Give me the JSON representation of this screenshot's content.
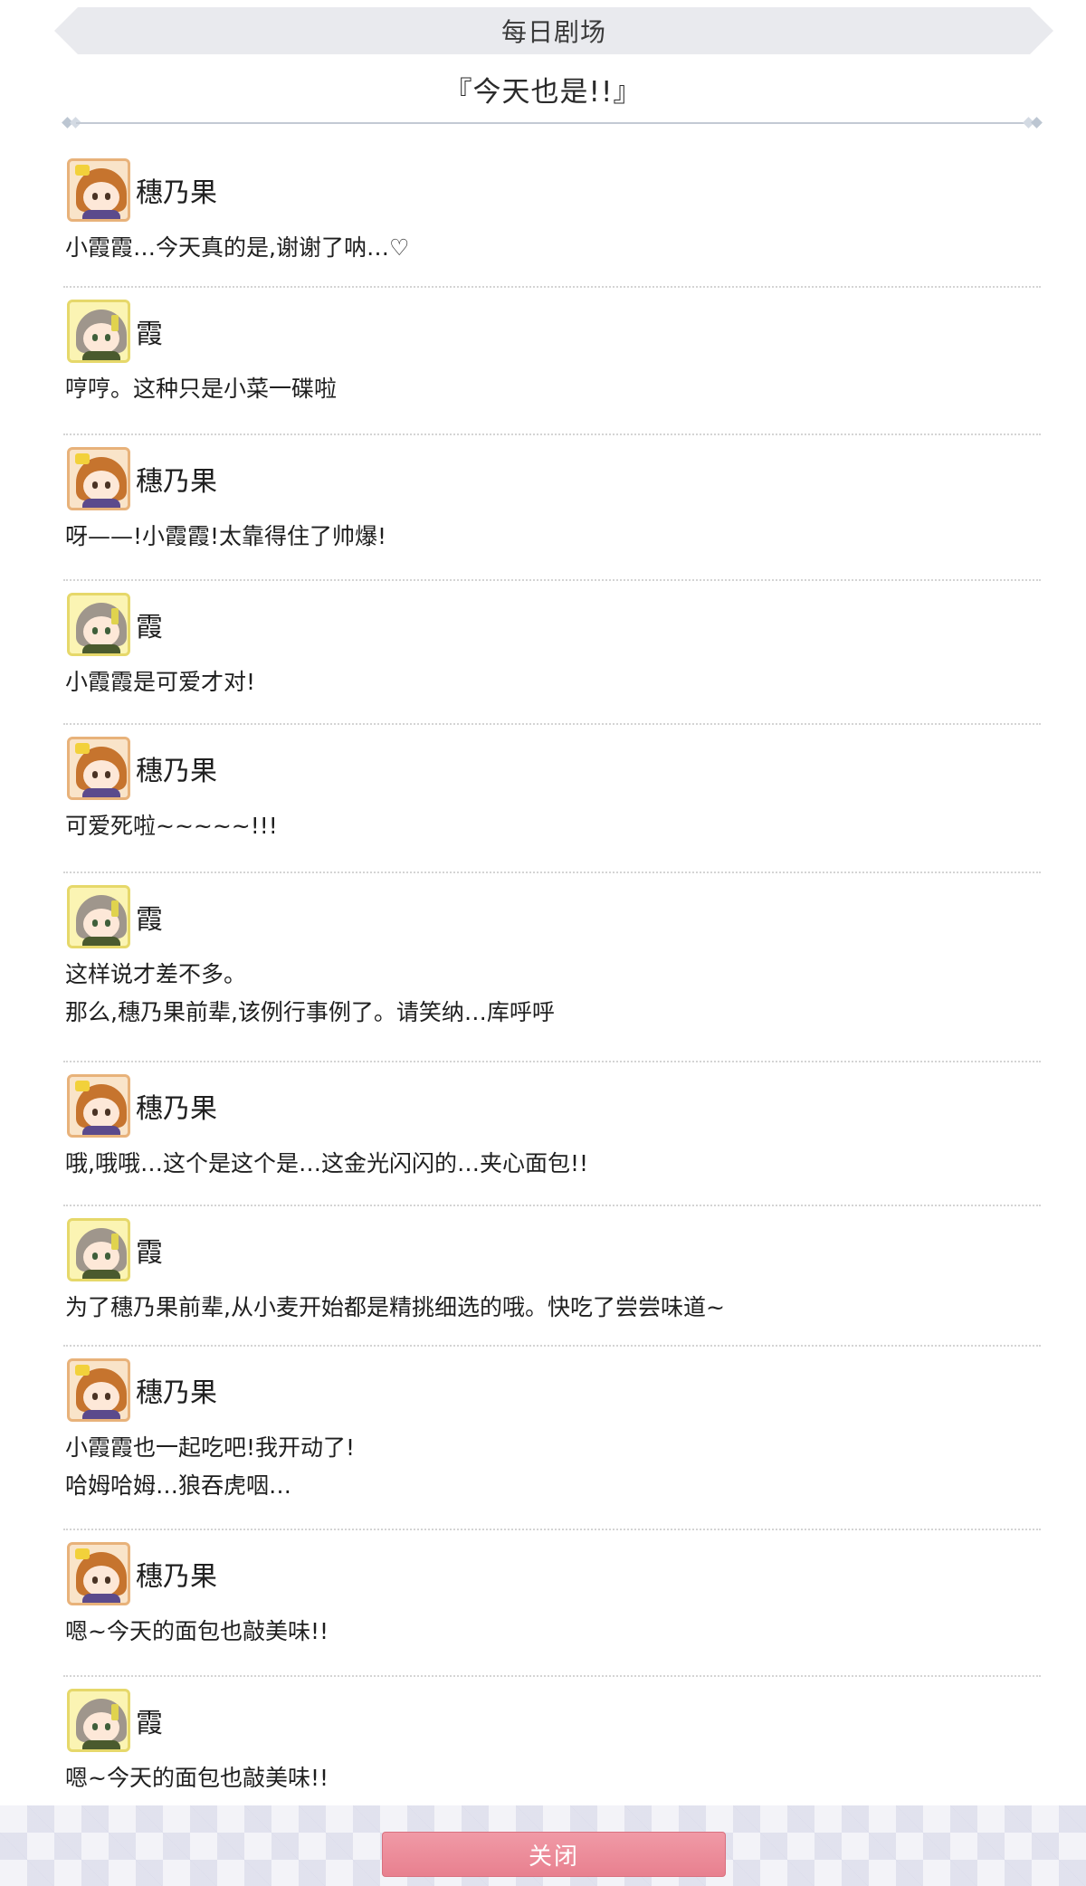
{
  "header": {
    "title": "每日剧场"
  },
  "drama": {
    "title": "『今天也是!!』"
  },
  "entries": [
    {
      "speaker": "穗乃果",
      "avatar": "honoka-avatar-icon",
      "lines": [
        "小霞霞…今天真的是,谢谢了呐…♡"
      ]
    },
    {
      "speaker": "霞",
      "avatar": "kasumi-avatar-icon",
      "lines": [
        "哼哼。这种只是小菜一碟啦"
      ]
    },
    {
      "speaker": "穗乃果",
      "avatar": "honoka-avatar-icon",
      "lines": [
        "呀——!小霞霞!太靠得住了帅爆!"
      ]
    },
    {
      "speaker": "霞",
      "avatar": "kasumi-avatar-icon",
      "lines": [
        "小霞霞是可爱才对!"
      ]
    },
    {
      "speaker": "穗乃果",
      "avatar": "honoka-avatar-icon",
      "lines": [
        "可爱死啦~~~~~!!!"
      ]
    },
    {
      "speaker": "霞",
      "avatar": "kasumi-avatar-icon",
      "lines": [
        "这样说才差不多。",
        "那么,穗乃果前辈,该例行事例了。请笑纳…库呼呼"
      ]
    },
    {
      "speaker": "穗乃果",
      "avatar": "honoka-avatar-icon",
      "lines": [
        "哦,哦哦…这个是这个是…这金光闪闪的…夹心面包!!"
      ]
    },
    {
      "speaker": "霞",
      "avatar": "kasumi-avatar-icon",
      "lines": [
        "为了穗乃果前辈,从小麦开始都是精挑细选的哦。快吃了尝尝味道~"
      ]
    },
    {
      "speaker": "穗乃果",
      "avatar": "honoka-avatar-icon",
      "lines": [
        "小霞霞也一起吃吧!我开动了!",
        "哈姆哈姆…狼吞虎咽…"
      ]
    },
    {
      "speaker": "穗乃果",
      "avatar": "honoka-avatar-icon",
      "lines": [
        "嗯~今天的面包也敲美味!!"
      ]
    },
    {
      "speaker": "霞",
      "avatar": "kasumi-avatar-icon",
      "lines": [
        "嗯~今天的面包也敲美味!!"
      ]
    }
  ],
  "footer": {
    "close_label": "关闭"
  },
  "colors": {
    "accent": "#e8808f",
    "divider": "#c3cad4"
  }
}
